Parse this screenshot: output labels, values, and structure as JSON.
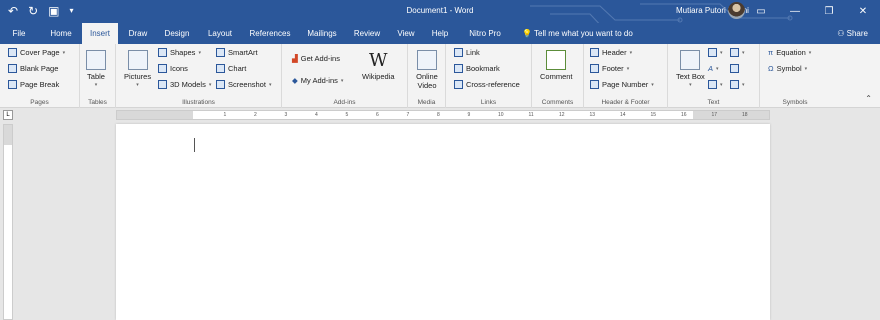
{
  "titlebar": {
    "doc_title": "Document1 - Word",
    "user_name": "Mutiara Putori Utami",
    "qat_icons": [
      "undo-icon",
      "redo-icon",
      "save-icon",
      "customize-icon"
    ],
    "window_controls": [
      "ribbon-display-icon",
      "minimize-icon",
      "restore-icon",
      "close-icon"
    ],
    "accent": "#2b579a"
  },
  "tabs": [
    "File",
    "Home",
    "Insert",
    "Draw",
    "Design",
    "Layout",
    "References",
    "Mailings",
    "Review",
    "View",
    "Help",
    "Nitro Pro"
  ],
  "active_tab": "Insert",
  "tell_me": "Tell me what you want to do",
  "share": "Share",
  "ribbon": {
    "pages": {
      "label": "Pages",
      "items": [
        "Cover Page",
        "Blank Page",
        "Page Break"
      ]
    },
    "tables": {
      "label": "Tables",
      "table": "Table"
    },
    "illustrations": {
      "label": "Illustrations",
      "pictures": "Pictures",
      "items": [
        "Shapes",
        "Icons",
        "3D Models"
      ],
      "items2": [
        "SmartArt",
        "Chart",
        "Screenshot"
      ]
    },
    "addins": {
      "label": "Add-ins",
      "items": [
        "Get Add-ins",
        "My Add-ins"
      ],
      "wikipedia": "Wikipedia"
    },
    "media": {
      "label": "Media",
      "online_video": "Online Video"
    },
    "links": {
      "label": "Links",
      "items": [
        "Link",
        "Bookmark",
        "Cross-reference"
      ]
    },
    "comments": {
      "label": "Comments",
      "comment": "Comment"
    },
    "header_footer": {
      "label": "Header & Footer",
      "items": [
        "Header",
        "Footer",
        "Page Number"
      ]
    },
    "text": {
      "label": "Text",
      "text_box": "Text Box"
    },
    "symbols": {
      "label": "Symbols",
      "items": [
        "Equation",
        "Symbol"
      ]
    }
  },
  "ruler": {
    "ticks": [
      "1",
      "2",
      "3",
      "4",
      "5",
      "6",
      "7",
      "8",
      "9",
      "10",
      "11",
      "12",
      "13",
      "14",
      "15",
      "16",
      "17",
      "18"
    ]
  },
  "ruler_corner": "L"
}
